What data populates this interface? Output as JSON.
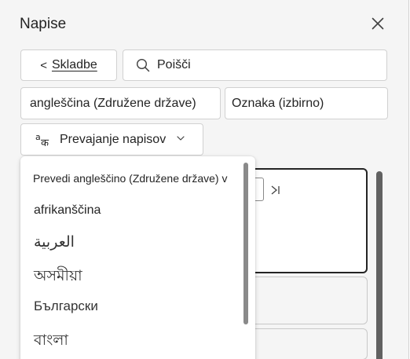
{
  "panel": {
    "title": "Napise"
  },
  "toolbar": {
    "back_arrow": "<",
    "back_label": "Skladbe",
    "search_text": "Poišči"
  },
  "fields": {
    "language": "angleščina (Združene države)",
    "label": "Oznaka (izbirno)"
  },
  "translate": {
    "label": "Prevajanje napisov"
  },
  "dropdown": {
    "header": "Prevedi angleščino (Združene države) v",
    "items": [
      "afrikanščina",
      "العربية",
      "অসমীয়া",
      "Български",
      "বাংলা"
    ]
  },
  "icons": [
    "close-icon",
    "search-icon",
    "translate-icon",
    "chevron-down-icon",
    "skip-next-icon"
  ]
}
